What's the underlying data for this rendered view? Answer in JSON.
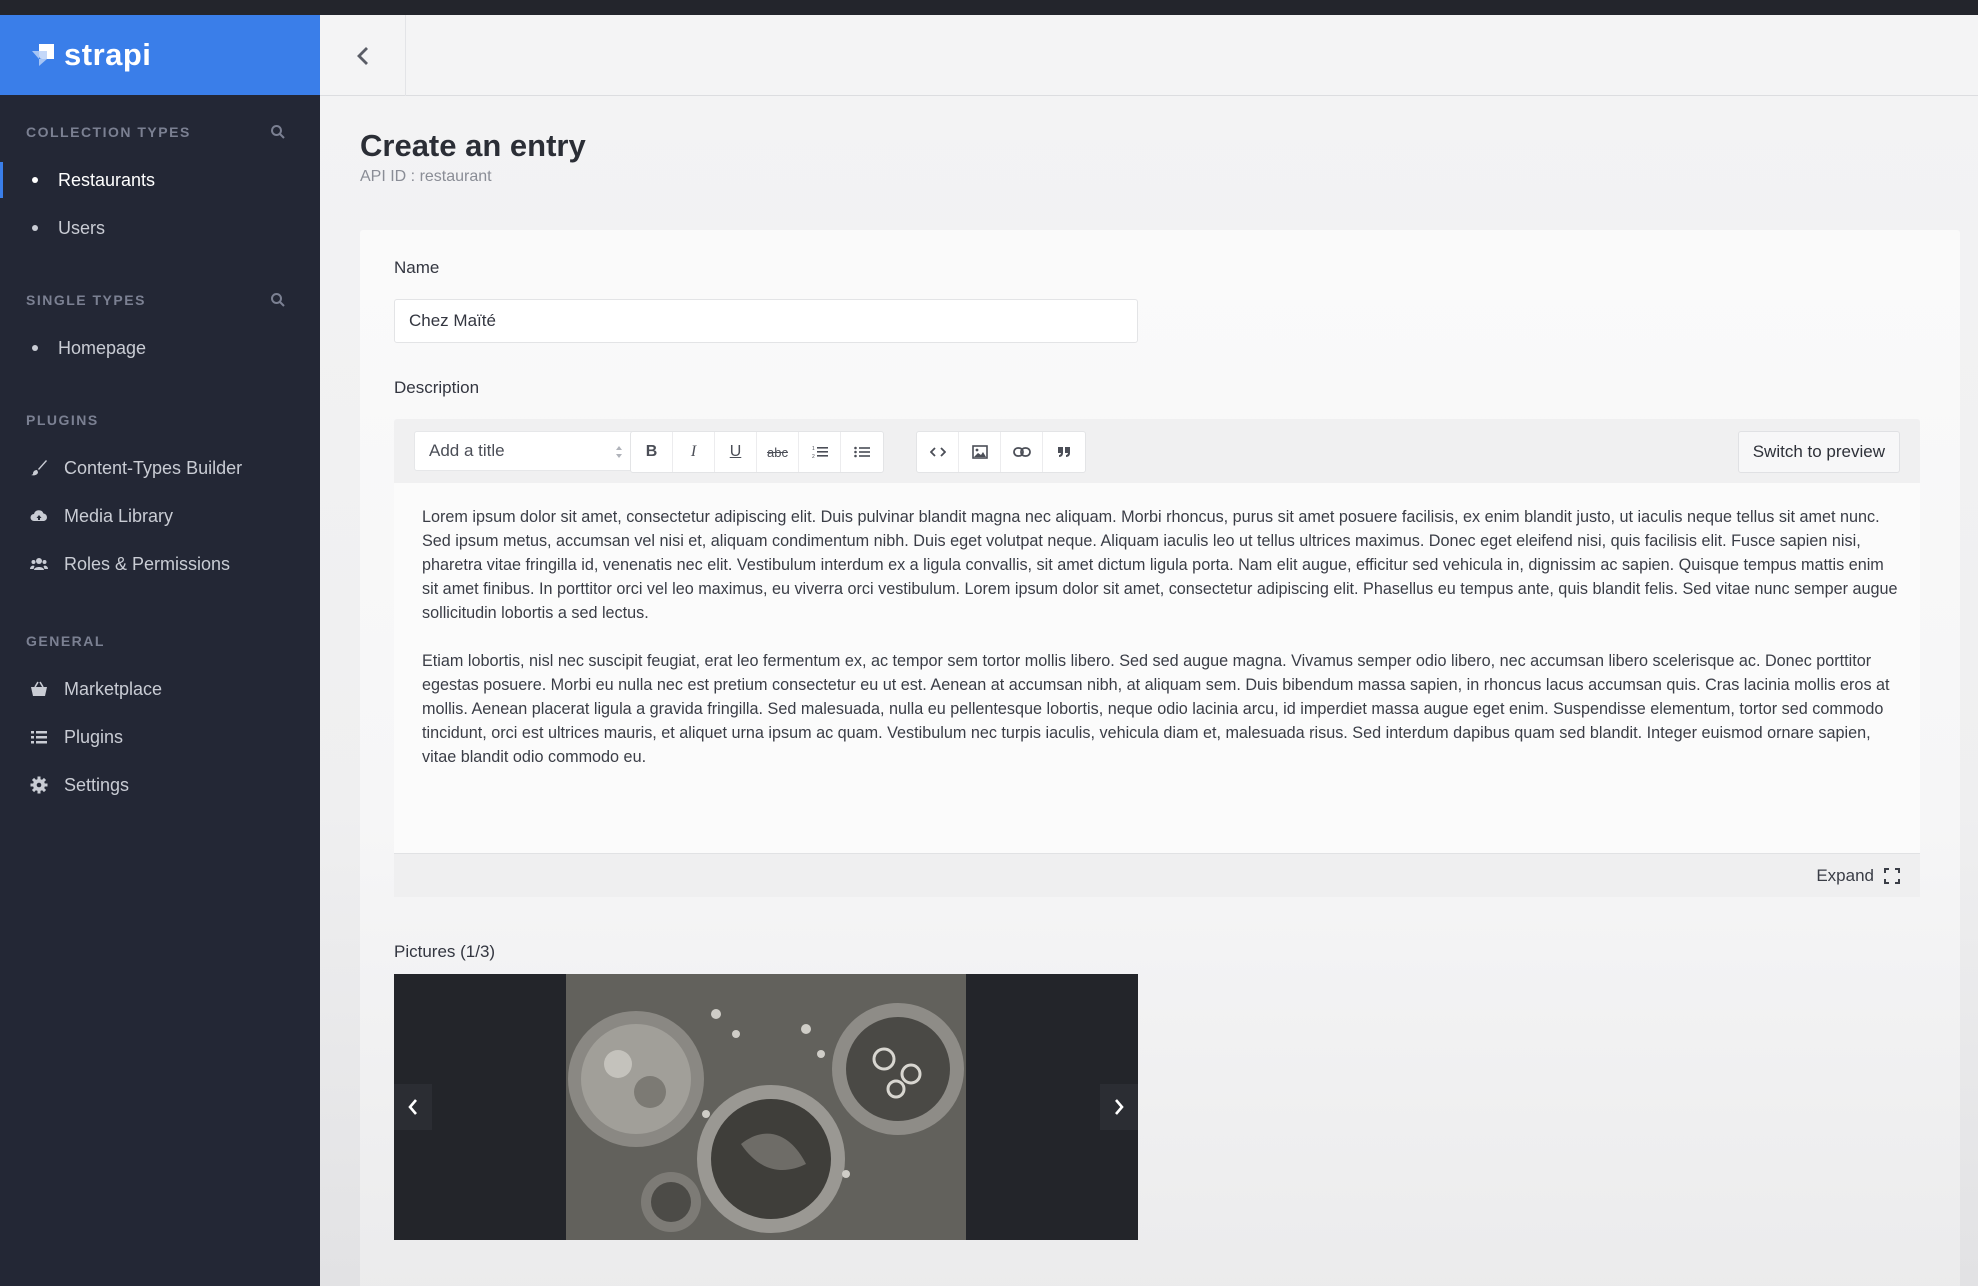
{
  "brand": {
    "name": "strapi"
  },
  "sidebar": {
    "sections": [
      {
        "title": "Collection Types",
        "items": [
          {
            "label": "Restaurants",
            "active": true
          },
          {
            "label": "Users"
          }
        ]
      },
      {
        "title": "Single Types",
        "items": [
          {
            "label": "Homepage"
          }
        ]
      },
      {
        "title": "Plugins",
        "items": [
          {
            "label": "Content-Types Builder",
            "icon": "paintbrush-icon"
          },
          {
            "label": "Media Library",
            "icon": "cloud-icon"
          },
          {
            "label": "Roles & Permissions",
            "icon": "users-icon"
          }
        ]
      },
      {
        "title": "General",
        "items": [
          {
            "label": "Marketplace",
            "icon": "basket-icon"
          },
          {
            "label": "Plugins",
            "icon": "list-icon"
          },
          {
            "label": "Settings",
            "icon": "gear-icon"
          }
        ]
      }
    ]
  },
  "page": {
    "title": "Create an entry",
    "subtitle": "API ID : restaurant"
  },
  "fields": {
    "name": {
      "label": "Name",
      "value": "Chez Maïté"
    },
    "description": {
      "label": "Description",
      "title_select": "Add a title",
      "toolbar_buttons": [
        "B",
        "I",
        "U",
        "abc"
      ],
      "preview_button": "Switch to preview",
      "paragraphs": [
        "Lorem ipsum dolor sit amet, consectetur adipiscing elit. Duis pulvinar blandit magna nec aliquam. Morbi rhoncus, purus sit amet posuere facilisis, ex enim blandit justo, ut iaculis neque tellus sit amet nunc. Sed ipsum metus, accumsan vel nisi et, aliquam condimentum nibh. Duis eget volutpat neque. Aliquam iaculis leo ut tellus ultrices maximus. Donec eget eleifend nisi, quis facilisis elit. Fusce sapien nisi, pharetra vitae fringilla id, venenatis nec elit. Vestibulum interdum ex a ligula convallis, sit amet dictum ligula porta. Nam elit augue, efficitur sed vehicula in, dignissim ac sapien. Quisque tempus mattis enim sit amet finibus. In porttitor orci vel leo maximus, eu viverra orci vestibulum. Lorem ipsum dolor sit amet, consectetur adipiscing elit. Phasellus eu tempus ante, quis blandit felis. Sed vitae nunc semper augue sollicitudin lobortis a sed lectus.",
        "Etiam lobortis, nisl nec suscipit feugiat, erat leo fermentum ex, ac tempor sem tortor mollis libero. Sed sed augue magna. Vivamus semper odio libero, nec accumsan libero scelerisque ac. Donec porttitor egestas posuere. Morbi eu nulla nec est pretium consectetur eu ut est. Aenean at accumsan nibh, at aliquam sem. Duis bibendum massa sapien, in rhoncus lacus accumsan quis. Cras lacinia mollis eros at mollis. Aenean placerat ligula a gravida fringilla. Sed malesuada, nulla eu pellentesque lobortis, neque odio lacinia arcu, id imperdiet massa augue eget enim. Suspendisse elementum, tortor sed commodo tincidunt, orci est ultrices mauris, et aliquet urna ipsum ac quam. Vestibulum nec turpis iaculis, vehicula diam et, malesuada risus. Sed interdum dapibus quam sed blandit. Integer euismod ornare sapien, vitae blandit odio commodo eu."
      ],
      "expand_label": "Expand"
    },
    "pictures": {
      "label": "Pictures (1/3)"
    }
  },
  "colors": {
    "brand": "#3a7ee9",
    "sidebar": "#232735"
  }
}
